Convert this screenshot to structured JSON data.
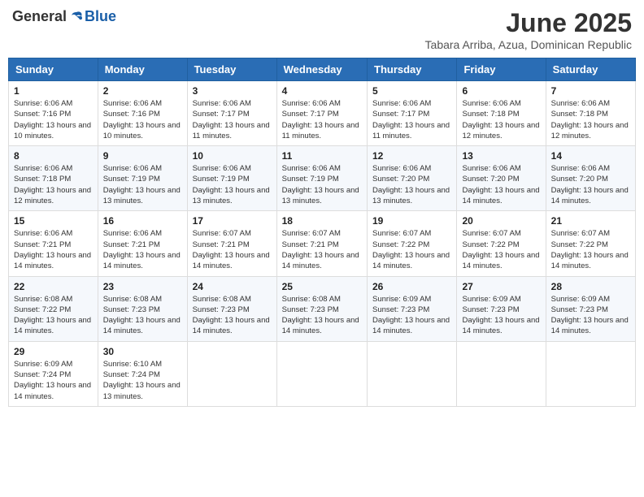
{
  "header": {
    "logo_general": "General",
    "logo_blue": "Blue",
    "month_year": "June 2025",
    "location": "Tabara Arriba, Azua, Dominican Republic"
  },
  "weekdays": [
    "Sunday",
    "Monday",
    "Tuesday",
    "Wednesday",
    "Thursday",
    "Friday",
    "Saturday"
  ],
  "weeks": [
    [
      {
        "day": 1,
        "sunrise": "6:06 AM",
        "sunset": "7:16 PM",
        "daylight": "13 hours and 10 minutes."
      },
      {
        "day": 2,
        "sunrise": "6:06 AM",
        "sunset": "7:16 PM",
        "daylight": "13 hours and 10 minutes."
      },
      {
        "day": 3,
        "sunrise": "6:06 AM",
        "sunset": "7:17 PM",
        "daylight": "13 hours and 11 minutes."
      },
      {
        "day": 4,
        "sunrise": "6:06 AM",
        "sunset": "7:17 PM",
        "daylight": "13 hours and 11 minutes."
      },
      {
        "day": 5,
        "sunrise": "6:06 AM",
        "sunset": "7:17 PM",
        "daylight": "13 hours and 11 minutes."
      },
      {
        "day": 6,
        "sunrise": "6:06 AM",
        "sunset": "7:18 PM",
        "daylight": "13 hours and 12 minutes."
      },
      {
        "day": 7,
        "sunrise": "6:06 AM",
        "sunset": "7:18 PM",
        "daylight": "13 hours and 12 minutes."
      }
    ],
    [
      {
        "day": 8,
        "sunrise": "6:06 AM",
        "sunset": "7:18 PM",
        "daylight": "13 hours and 12 minutes."
      },
      {
        "day": 9,
        "sunrise": "6:06 AM",
        "sunset": "7:19 PM",
        "daylight": "13 hours and 13 minutes."
      },
      {
        "day": 10,
        "sunrise": "6:06 AM",
        "sunset": "7:19 PM",
        "daylight": "13 hours and 13 minutes."
      },
      {
        "day": 11,
        "sunrise": "6:06 AM",
        "sunset": "7:19 PM",
        "daylight": "13 hours and 13 minutes."
      },
      {
        "day": 12,
        "sunrise": "6:06 AM",
        "sunset": "7:20 PM",
        "daylight": "13 hours and 13 minutes."
      },
      {
        "day": 13,
        "sunrise": "6:06 AM",
        "sunset": "7:20 PM",
        "daylight": "13 hours and 14 minutes."
      },
      {
        "day": 14,
        "sunrise": "6:06 AM",
        "sunset": "7:20 PM",
        "daylight": "13 hours and 14 minutes."
      }
    ],
    [
      {
        "day": 15,
        "sunrise": "6:06 AM",
        "sunset": "7:21 PM",
        "daylight": "13 hours and 14 minutes."
      },
      {
        "day": 16,
        "sunrise": "6:06 AM",
        "sunset": "7:21 PM",
        "daylight": "13 hours and 14 minutes."
      },
      {
        "day": 17,
        "sunrise": "6:07 AM",
        "sunset": "7:21 PM",
        "daylight": "13 hours and 14 minutes."
      },
      {
        "day": 18,
        "sunrise": "6:07 AM",
        "sunset": "7:21 PM",
        "daylight": "13 hours and 14 minutes."
      },
      {
        "day": 19,
        "sunrise": "6:07 AM",
        "sunset": "7:22 PM",
        "daylight": "13 hours and 14 minutes."
      },
      {
        "day": 20,
        "sunrise": "6:07 AM",
        "sunset": "7:22 PM",
        "daylight": "13 hours and 14 minutes."
      },
      {
        "day": 21,
        "sunrise": "6:07 AM",
        "sunset": "7:22 PM",
        "daylight": "13 hours and 14 minutes."
      }
    ],
    [
      {
        "day": 22,
        "sunrise": "6:08 AM",
        "sunset": "7:22 PM",
        "daylight": "13 hours and 14 minutes."
      },
      {
        "day": 23,
        "sunrise": "6:08 AM",
        "sunset": "7:23 PM",
        "daylight": "13 hours and 14 minutes."
      },
      {
        "day": 24,
        "sunrise": "6:08 AM",
        "sunset": "7:23 PM",
        "daylight": "13 hours and 14 minutes."
      },
      {
        "day": 25,
        "sunrise": "6:08 AM",
        "sunset": "7:23 PM",
        "daylight": "13 hours and 14 minutes."
      },
      {
        "day": 26,
        "sunrise": "6:09 AM",
        "sunset": "7:23 PM",
        "daylight": "13 hours and 14 minutes."
      },
      {
        "day": 27,
        "sunrise": "6:09 AM",
        "sunset": "7:23 PM",
        "daylight": "13 hours and 14 minutes."
      },
      {
        "day": 28,
        "sunrise": "6:09 AM",
        "sunset": "7:23 PM",
        "daylight": "13 hours and 14 minutes."
      }
    ],
    [
      {
        "day": 29,
        "sunrise": "6:09 AM",
        "sunset": "7:24 PM",
        "daylight": "13 hours and 14 minutes."
      },
      {
        "day": 30,
        "sunrise": "6:10 AM",
        "sunset": "7:24 PM",
        "daylight": "13 hours and 13 minutes."
      },
      null,
      null,
      null,
      null,
      null
    ]
  ],
  "labels": {
    "sunrise_prefix": "Sunrise: ",
    "sunset_prefix": "Sunset: ",
    "daylight_prefix": "Daylight: "
  }
}
